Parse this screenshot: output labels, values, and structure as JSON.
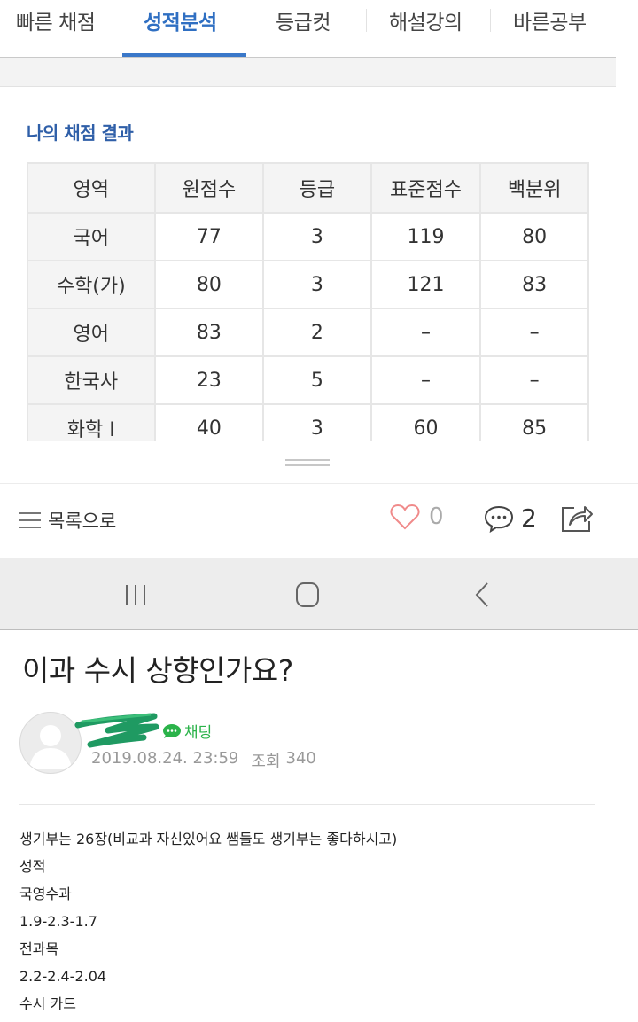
{
  "tabs": [
    {
      "label": "빠른 채점",
      "active": false
    },
    {
      "label": "성적분석",
      "active": true
    },
    {
      "label": "등급컷",
      "active": false
    },
    {
      "label": "해설강의",
      "active": false
    },
    {
      "label": "바른공부",
      "active": false
    }
  ],
  "result": {
    "title": "나의 채점 결과",
    "headers": [
      "영역",
      "원점수",
      "등급",
      "표준점수",
      "백분위"
    ],
    "rows": [
      [
        "국어",
        "77",
        "3",
        "119",
        "80"
      ],
      [
        "수학(가)",
        "80",
        "3",
        "121",
        "83"
      ],
      [
        "영어",
        "83",
        "2",
        "–",
        "–"
      ],
      [
        "한국사",
        "23",
        "5",
        "–",
        "–"
      ],
      [
        "화학 I",
        "40",
        "3",
        "60",
        "85"
      ]
    ]
  },
  "actions": {
    "list_label": "목록으로",
    "like_count": "0",
    "comment_count": "2"
  },
  "post": {
    "title": "이과 수시 상향인가요?",
    "chat_label": "채팅",
    "date": "2019.08.24. 23:59",
    "views_label": "조회",
    "views": "340",
    "lines": [
      "생기부는 26장(비교과 자신있어요 쌤들도 생기부는 좋다하시고)",
      "성적",
      "국영수과",
      "1.9-2.3-1.7",
      "전과목",
      "2.2-2.4-2.04",
      "수시 카드"
    ]
  },
  "colors": {
    "accent": "#3a78c9",
    "chat_green": "#2bb34a"
  }
}
